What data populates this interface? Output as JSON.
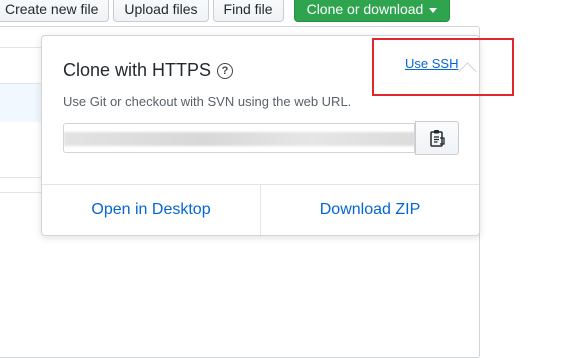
{
  "toolbar": {
    "create_file_label": "Create new file",
    "upload_label": "Upload files",
    "find_label": "Find file",
    "clone_label": "Clone or download"
  },
  "clone_panel": {
    "title": "Clone with HTTPS",
    "switch_link": "Use SSH",
    "description": "Use Git or checkout with SVN using the web URL.",
    "url_value": "",
    "actions": {
      "open_desktop": "Open in Desktop",
      "download_zip": "Download ZIP"
    }
  },
  "icons": {
    "help": "question-circle-icon",
    "copy": "clipboard-icon",
    "caret": "caret-down-icon"
  },
  "colors": {
    "primary_green": "#2ea44f",
    "link_blue": "#0366d6",
    "annotation_red": "#e3262d"
  }
}
